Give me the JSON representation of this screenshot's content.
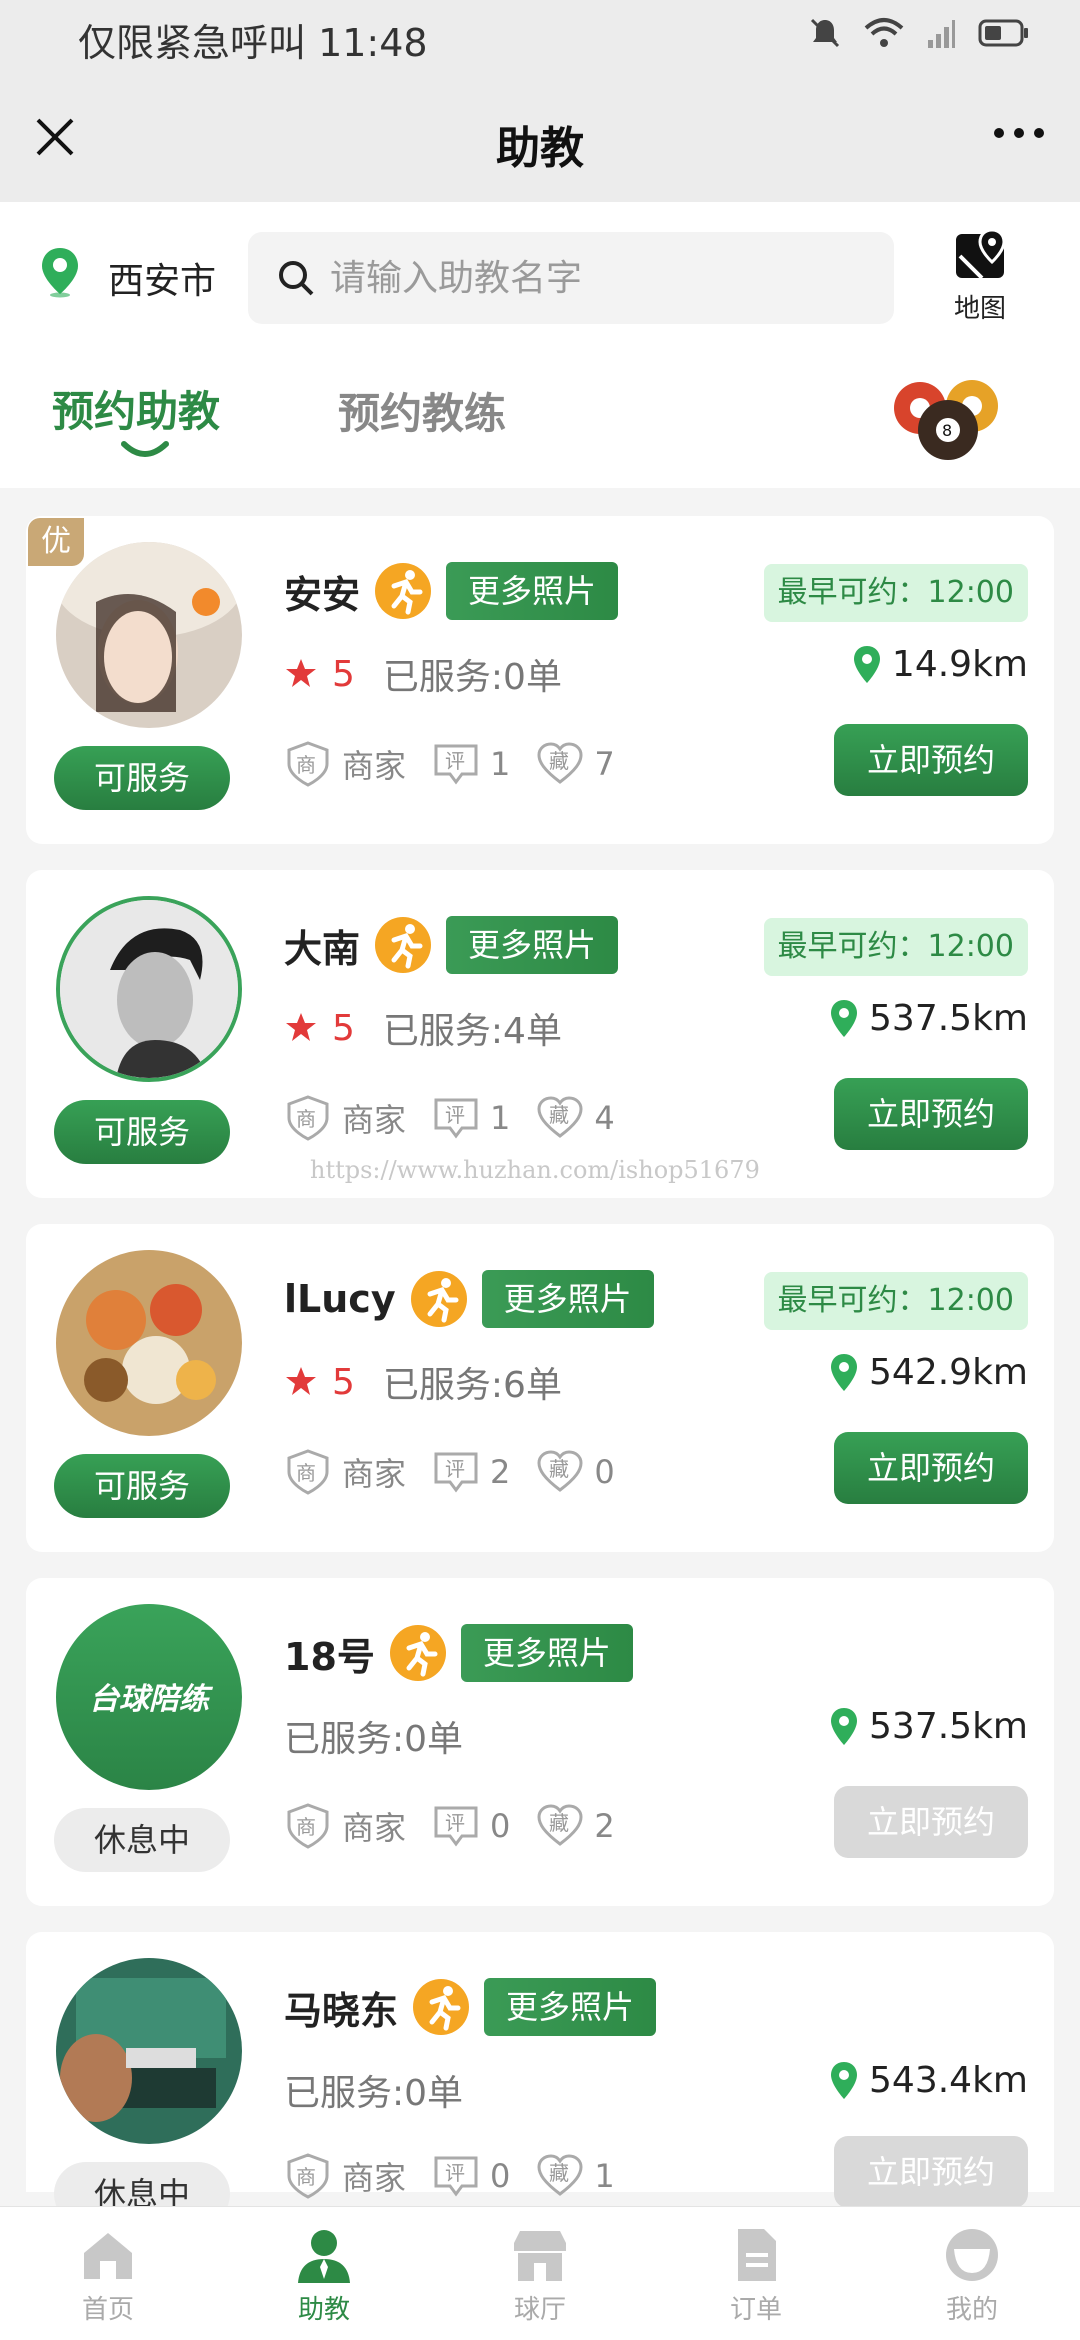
{
  "status_bar": {
    "text": "仅限紧急呼叫 11:48"
  },
  "nav": {
    "title": "助教"
  },
  "location": {
    "city": "西安市"
  },
  "search": {
    "placeholder": "请输入助教名字"
  },
  "map": {
    "label": "地图"
  },
  "tabs": [
    {
      "label": "预约助教",
      "active": true
    },
    {
      "label": "预约教练",
      "active": false
    }
  ],
  "common": {
    "photos_label": "更多照片",
    "merchant_label": "商家",
    "review_glyph": "评",
    "fav_glyph": "藏",
    "merchant_glyph": "商",
    "book_label": "立即预约",
    "time_label": "最早可约：12:00"
  },
  "coaches": [
    {
      "name": "安安",
      "badge": "优",
      "rating": "5",
      "served": "已服务:0单",
      "reviews": "1",
      "favorites": "7",
      "distance": "14.9km",
      "status": "可服务",
      "available": true
    },
    {
      "name": "大南",
      "rating": "5",
      "served": "已服务:4单",
      "reviews": "1",
      "favorites": "4",
      "distance": "537.5km",
      "status": "可服务",
      "available": true
    },
    {
      "name": "lLucy",
      "rating": "5",
      "served": "已服务:6单",
      "reviews": "2",
      "favorites": "0",
      "distance": "542.9km",
      "status": "可服务",
      "available": true
    },
    {
      "name": "18号",
      "avatar_text": "台球陪练",
      "served": "已服务:0单",
      "reviews": "0",
      "favorites": "2",
      "distance": "537.5km",
      "status": "休息中",
      "available": false
    },
    {
      "name": "马晓东",
      "served": "已服务:0单",
      "reviews": "0",
      "favorites": "1",
      "distance": "543.4km",
      "status": "休息中",
      "available": false
    }
  ],
  "watermark": "https://www.huzhan.com/ishop51679",
  "bottom_nav": [
    {
      "label": "首页",
      "active": false
    },
    {
      "label": "助教",
      "active": true
    },
    {
      "label": "球厅",
      "active": false
    },
    {
      "label": "订单",
      "active": false
    },
    {
      "label": "我的",
      "active": false
    }
  ],
  "colors": {
    "brand_green": "#2d8a45",
    "rating_red": "#e23a3a",
    "badge_gold": "#c9a876",
    "run_orange": "#f5a623"
  }
}
